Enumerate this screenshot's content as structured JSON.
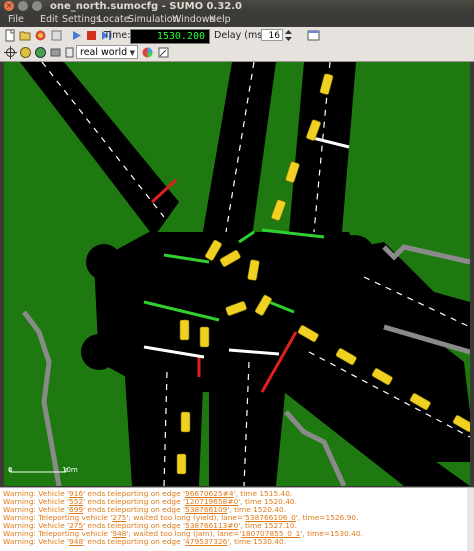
{
  "window": {
    "title": "one_north.sumocfg - SUMO 0.32.0"
  },
  "menu": [
    "File",
    "Edit",
    "Settings",
    "Locate",
    "Simulation",
    "Windows",
    "Help"
  ],
  "toolbar": {
    "time_label": "Time:",
    "time_value": "1530.200",
    "delay_label": "Delay (ms):",
    "delay_value": "16"
  },
  "viewbar": {
    "scheme_selected": "real world"
  },
  "canvas": {
    "scale_start": "0",
    "scale_end": "10m"
  },
  "log": [
    {
      "prefix": "Warning: Vehicle '",
      "id": "916",
      "mid": "' ends teleporting on edge '",
      "edge": "96670625#4",
      "suffix": "', time 1515.40."
    },
    {
      "prefix": "Warning: Vehicle '",
      "id": "552",
      "mid": "' ends teleporting on edge '",
      "edge": "120719658#0",
      "suffix": "', time 1520.40."
    },
    {
      "prefix": "Warning: Vehicle '",
      "id": "699",
      "mid": "' ends teleporting on edge '",
      "edge": "538766109",
      "suffix": "', time 1520.40."
    },
    {
      "prefix": "Warning: Teleporting vehicle '",
      "id": "275",
      "mid": "'; waited too long (yield), lane='",
      "edge": "538766106_0",
      "suffix": "', time=1526.90."
    },
    {
      "prefix": "Warning: Vehicle '",
      "id": "275",
      "mid": "' ends teleporting on edge '",
      "edge": "538766113#0",
      "suffix": "', time 1527.10."
    },
    {
      "prefix": "Warning: Teleporting vehicle '",
      "id": "948",
      "mid": "'; waited too long (jam), lane='",
      "edge": "180707855_0_1",
      "suffix": "', time=1530.40."
    },
    {
      "prefix": "Warning: Vehicle '",
      "id": "948",
      "mid": "' ends teleporting on edge '",
      "edge": "479537326",
      "suffix": "', time 1530.40."
    }
  ]
}
